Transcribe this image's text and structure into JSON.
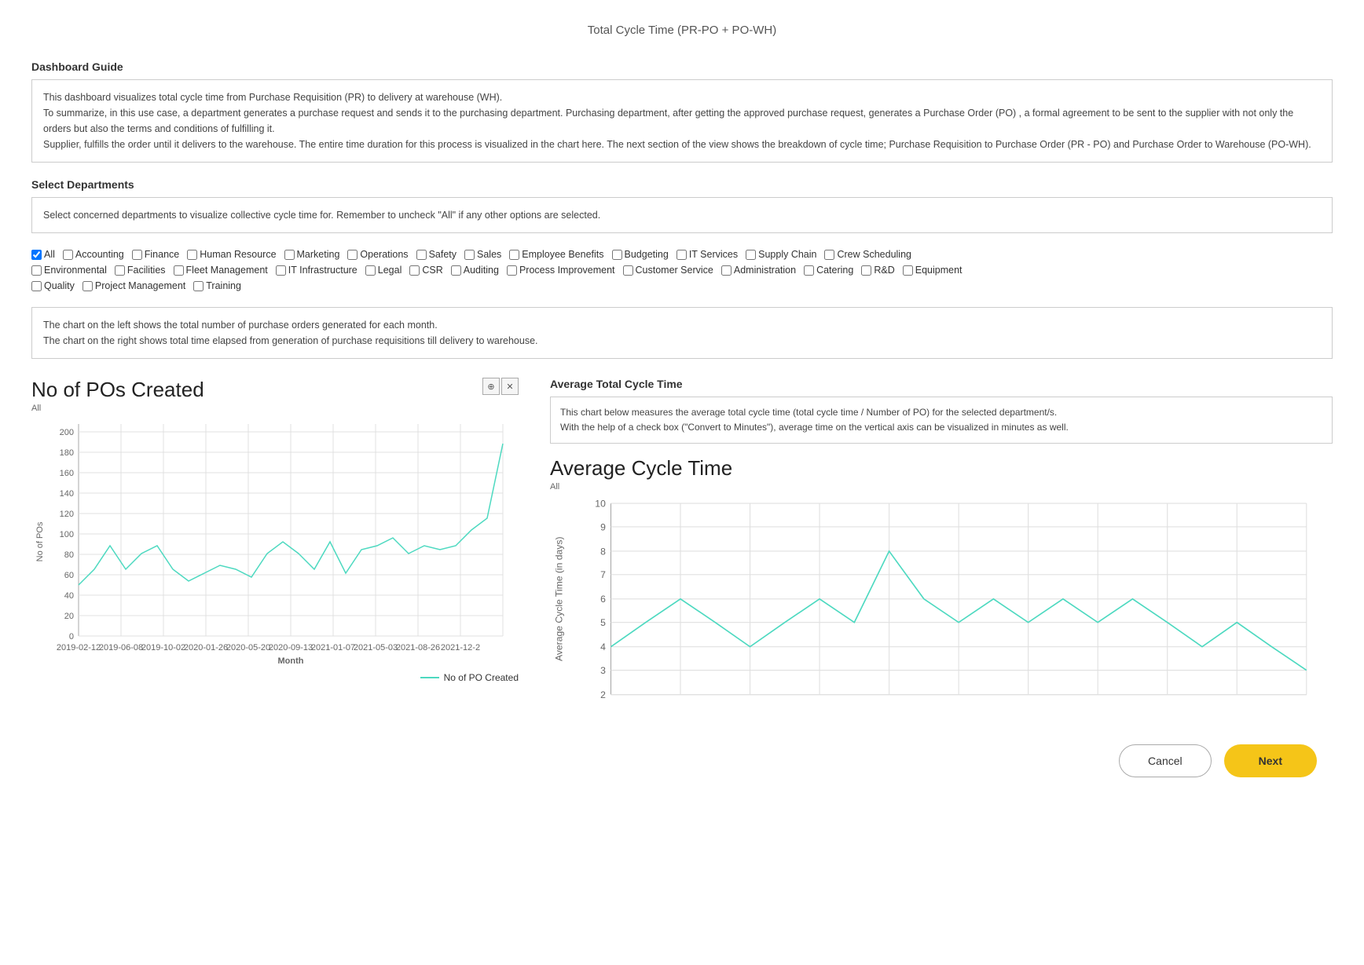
{
  "page": {
    "title": "Total Cycle Time (PR-PO + PO-WH)"
  },
  "dashboard_guide": {
    "label": "Dashboard Guide",
    "text_lines": [
      "This dashboard visualizes total cycle time from Purchase Requisition (PR) to delivery at warehouse (WH).",
      "To summarize, in this use case, a department generates a purchase request and sends it to the purchasing department. Purchasing department, after getting the approved purchase request, generates a Purchase Order (PO) , a formal agreement to be sent to the supplier with not only the orders but also the terms and conditions of fulfilling it.",
      "Supplier, fulfills the order until it delivers to the warehouse. The entire time duration for this process is visualized in the chart here. The next section of the view shows the breakdown of cycle time; Purchase Requisition to Purchase Order (PR - PO) and Purchase Order to Warehouse (PO-WH)."
    ]
  },
  "select_departments": {
    "label": "Select Departments",
    "hint": "Select concerned departments to visualize collective cycle time for. Remember to uncheck \"All\" if any other options are selected.",
    "rows": [
      [
        {
          "id": "all",
          "label": "All",
          "checked": true
        },
        {
          "id": "accounting",
          "label": "Accounting",
          "checked": false
        },
        {
          "id": "finance",
          "label": "Finance",
          "checked": false
        },
        {
          "id": "human_resource",
          "label": "Human Resource",
          "checked": false
        },
        {
          "id": "marketing",
          "label": "Marketing",
          "checked": false
        },
        {
          "id": "operations",
          "label": "Operations",
          "checked": false
        },
        {
          "id": "safety",
          "label": "Safety",
          "checked": false
        },
        {
          "id": "sales",
          "label": "Sales",
          "checked": false
        },
        {
          "id": "employee_benefits",
          "label": "Employee Benefits",
          "checked": false
        },
        {
          "id": "budgeting",
          "label": "Budgeting",
          "checked": false
        },
        {
          "id": "it_services",
          "label": "IT Services",
          "checked": false
        },
        {
          "id": "supply_chain",
          "label": "Supply Chain",
          "checked": false
        },
        {
          "id": "crew_scheduling",
          "label": "Crew Scheduling",
          "checked": false
        }
      ],
      [
        {
          "id": "environmental",
          "label": "Environmental",
          "checked": false
        },
        {
          "id": "facilities",
          "label": "Facilities",
          "checked": false
        },
        {
          "id": "fleet_management",
          "label": "Fleet Management",
          "checked": false
        },
        {
          "id": "it_infrastructure",
          "label": "IT Infrastructure",
          "checked": false
        },
        {
          "id": "legal",
          "label": "Legal",
          "checked": false
        },
        {
          "id": "csr",
          "label": "CSR",
          "checked": false
        },
        {
          "id": "auditing",
          "label": "Auditing",
          "checked": false
        },
        {
          "id": "process_improvement",
          "label": "Process Improvement",
          "checked": false
        },
        {
          "id": "customer_service",
          "label": "Customer Service",
          "checked": false
        },
        {
          "id": "administration",
          "label": "Administration",
          "checked": false
        },
        {
          "id": "catering",
          "label": "Catering",
          "checked": false
        },
        {
          "id": "rnd",
          "label": "R&D",
          "checked": false
        },
        {
          "id": "equipment",
          "label": "Equipment",
          "checked": false
        }
      ],
      [
        {
          "id": "quality",
          "label": "Quality",
          "checked": false
        },
        {
          "id": "project_management",
          "label": "Project Management",
          "checked": false
        },
        {
          "id": "training",
          "label": "Training",
          "checked": false
        }
      ]
    ]
  },
  "chart_info": {
    "line1": "The chart on the left shows the total number of purchase orders generated for each month.",
    "line2": "The chart on the right shows total time elapsed from generation of purchase requisitions till delivery to warehouse."
  },
  "left_chart": {
    "title": "No of POs Created",
    "subtitle": "All",
    "x_axis_label": "Month",
    "y_axis_label": "No of POs",
    "legend_label": "No of PO Created",
    "zoom_icon": "🔍",
    "reset_icon": "✕"
  },
  "right_chart": {
    "title": "Average Total Cycle Time",
    "info_text_lines": [
      "This chart below measures the average total cycle time (total cycle time / Number of PO) for the selected department/s.",
      "With the help of a check box (\"Convert to Minutes\"), average time on the vertical axis can be visualized in minutes as well."
    ],
    "avg_chart_title": "Average Cycle Time",
    "subtitle": "All",
    "y_axis_label": "Average Cycle Time (in days)"
  },
  "buttons": {
    "cancel": "Cancel",
    "next": "Next"
  }
}
